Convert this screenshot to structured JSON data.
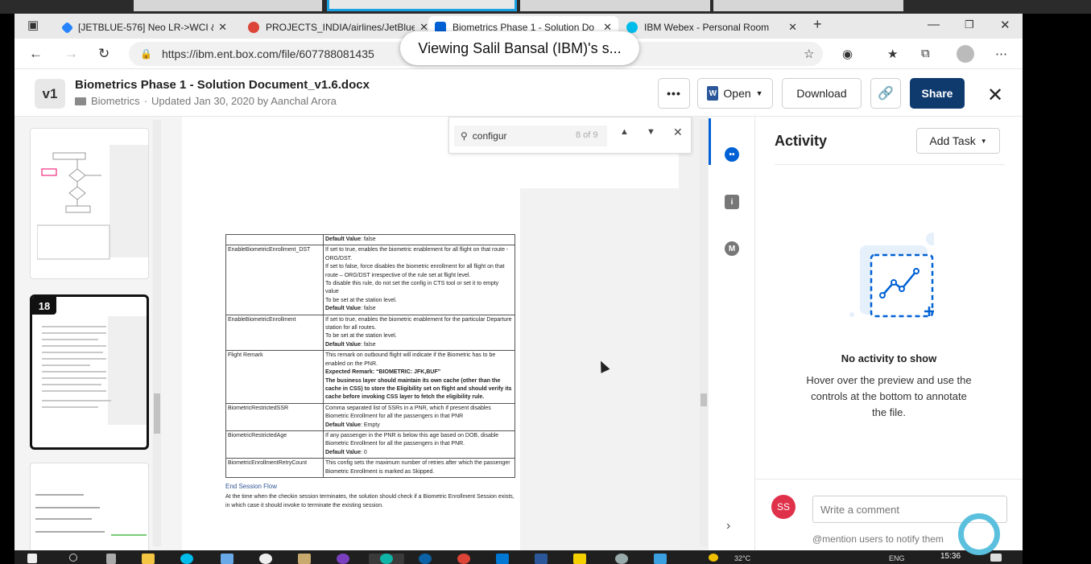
{
  "colors": {
    "box_blue": "#0061d5",
    "share_btn": "#0e3a6e",
    "avatar_red": "#e0314a",
    "link_blue": "#2f5597"
  },
  "sharing_banner": {
    "text": "Viewing Salil Bansal (IBM)'s s..."
  },
  "browser": {
    "tabs": [
      {
        "label": "[JETBLUE-576] Neo LR->WCI & I",
        "icon": "jira-icon",
        "active": false
      },
      {
        "label": "PROJECTS_INDIA/airlines/JetBlue",
        "icon": "chrome-icon",
        "active": false
      },
      {
        "label": "Biometrics Phase 1 - Solution Do",
        "icon": "box-icon",
        "active": true
      },
      {
        "label": "IBM Webex - Personal Room",
        "icon": "webex-icon",
        "active": false
      }
    ],
    "url": "https://ibm.ent.box.com/file/607788081435"
  },
  "file_header": {
    "version": "v1",
    "title": "Biometrics Phase 1 - Solution Document_v1.6.docx",
    "folder": "Biometrics",
    "updated": "Updated Jan 30, 2020 by Aanchal Arora",
    "more_label": "•••",
    "open_label": "Open",
    "download_label": "Download",
    "share_label": "Share"
  },
  "thumbnails": {
    "selected_page": "18"
  },
  "find_bar": {
    "query": "configur",
    "count": "8 of 9"
  },
  "document": {
    "rows": [
      {
        "key": "",
        "value_html": "<b>Default Value</b>: false"
      },
      {
        "key": "EnableBiometricEnrollment_DST",
        "value_html": "If set to true, enables the biometric enablement for all flight on that route - ORG/DST.<br>If set to false, force disables the biometric enrollment for all flight on that route – ORG/DST irrespective of the rule set at flight level.<br>To disable this rule, do not set the config in CTS tool or set it to empty value<br>To be set at the station level.<br><b>Default Value</b>: false"
      },
      {
        "key": "EnableBiometricEnrollment",
        "value_html": "If set to true, enables the biometric enablement for the particular Departure station for all routes.<br>To be set at the station level.<br><b>Default Value</b>: false"
      },
      {
        "key": "Flight Remark",
        "value_html": "This remark on outbound flight will indicate if the Biometric has to be enabled on the PNR.<br><b>Expected Remark: “BIOMETRIC: JFK,BUF”</b><br><b>The business layer should maintain its own cache (other than the cache in CSS) to store the Eligibility set on flight and should verify its cache before invoking CSS layer to fetch the eligibility rule.</b>"
      },
      {
        "key": "BiometricRestrictedSSR",
        "value_html": "Comma separated list of SSRs in a PNR, which if present disables Biometric Enrollment for all the passengers in that PNR<br><b>Default Value</b>: Empty"
      },
      {
        "key": "BiometricRestrictedAge",
        "value_html": "If any passenger in the PNR is below this age based on DOB, disable Biometric Enrollment for all the passengers in that PNR.<br><b>Default Value</b>: 0"
      },
      {
        "key": "BiometricEnrollmentRetryCount",
        "value_html": "This config sets the maximum number of retries after which the passenger Biometric Enrollment is marked as Skipped."
      }
    ],
    "end_session_heading": "End Session Flow",
    "end_session_text": "At the time when the checkin session terminates, the solution should check if a Biometric Enrollment Session exists, in which case it should invoke to terminate the existing session."
  },
  "activity": {
    "title": "Activity",
    "add_task_label": "Add Task",
    "empty_title": "No activity to show",
    "empty_text": "Hover over the preview and use the controls at the bottom to annotate the file.",
    "user_initials": "SS",
    "comment_placeholder": "Write a comment",
    "mention_hint": "@mention users to notify them"
  },
  "taskbar": {
    "time": "15:36",
    "temp": "32°C",
    "lang": "ENG"
  }
}
